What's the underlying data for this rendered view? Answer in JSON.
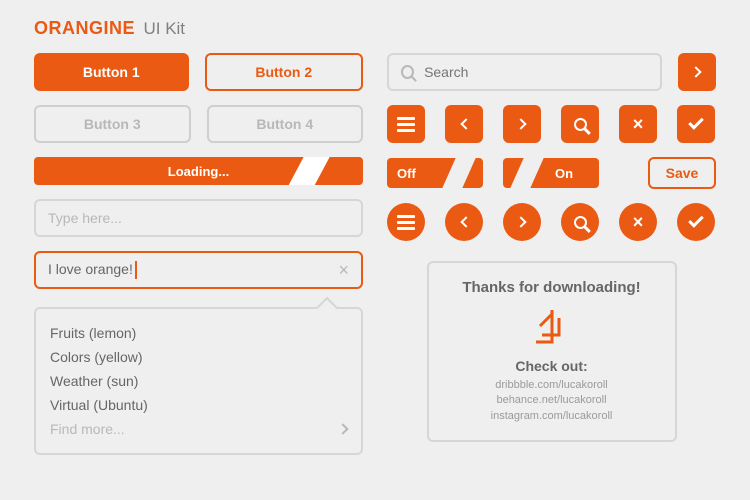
{
  "title": {
    "brand": "ORANGINE",
    "sub": "UI Kit"
  },
  "buttons": {
    "b1": "Button 1",
    "b2": "Button 2",
    "b3": "Button 3",
    "b4": "Button 4"
  },
  "progress": {
    "label": "Loading..."
  },
  "inputs": {
    "placeholder": "Type here...",
    "active_value": "I love orange!"
  },
  "dropdown": {
    "items": [
      "Fruits (lemon)",
      "Colors (yellow)",
      "Weather (sun)",
      "Virtual (Ubuntu)"
    ],
    "more": "Find more..."
  },
  "search": {
    "placeholder": "Search"
  },
  "toggles": {
    "off": "Off",
    "on": "On"
  },
  "save": "Save",
  "card": {
    "thanks": "Thanks for downloading!",
    "checkout": "Check out:",
    "links": [
      "dribbble.com/lucakoroll",
      "behance.net/lucakoroll",
      "instagram.com/lucakoroll"
    ]
  }
}
